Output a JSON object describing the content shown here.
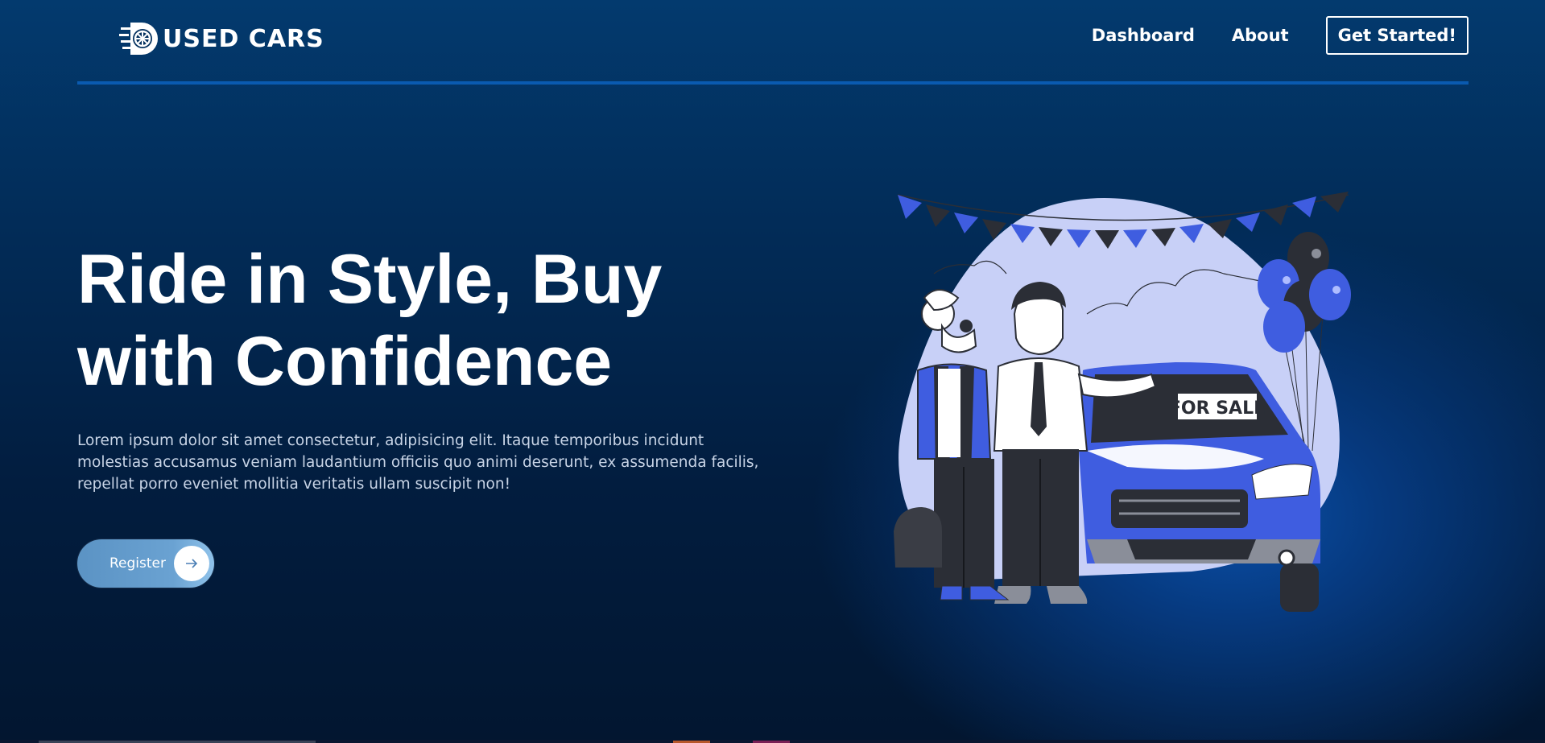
{
  "header": {
    "logo_text": "USED CARS",
    "logo_icon": "wheel-icon",
    "nav": [
      "Dashboard",
      "About"
    ],
    "cta_label": "Get Started!"
  },
  "hero": {
    "title_line1": "Ride in Style, Buy",
    "title_line2": "with Confidence",
    "description": "Lorem ipsum dolor sit amet consectetur, adipisicing elit. Itaque temporibus incidunt molestias accusamus veniam laudantium officiis quo animi deserunt, ex assumenda facilis, repellat porro eveniet mollitia veritatis ullam suscipit non!",
    "register_label": "Register",
    "register_icon": "arrow-right-icon"
  },
  "illustration": {
    "sign_text": "FOR SALE",
    "accent": "#3f5de0",
    "blob": "#c8d0f7",
    "dark": "#2b2e36"
  },
  "colors": {
    "background_top": "#033a6e",
    "background_bottom": "#021630",
    "divider": "#0a5ab0"
  }
}
